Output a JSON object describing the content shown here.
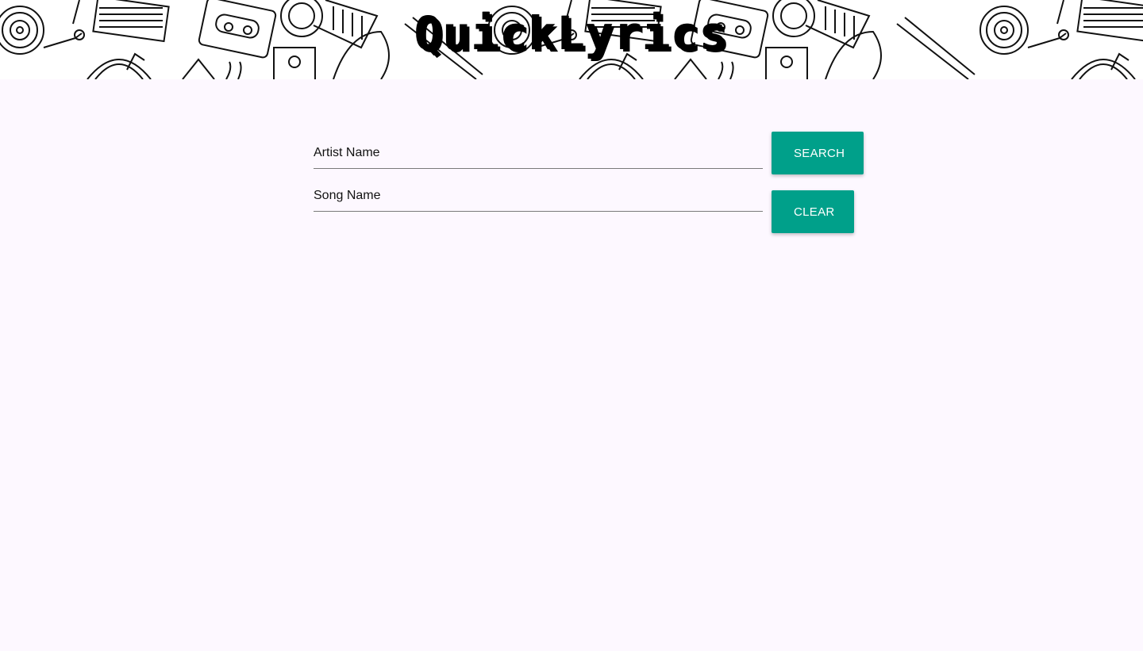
{
  "header": {
    "title": "QuickLyrics"
  },
  "form": {
    "artist_placeholder": "Artist Name",
    "artist_value": "",
    "song_placeholder": "Song Name",
    "song_value": "",
    "search_label": "SEARCH",
    "clear_label": "CLEAR"
  },
  "colors": {
    "accent": "#00a08a",
    "background": "#fdf8ff"
  },
  "icons": {
    "header_pattern": "music-doodle-pattern"
  }
}
